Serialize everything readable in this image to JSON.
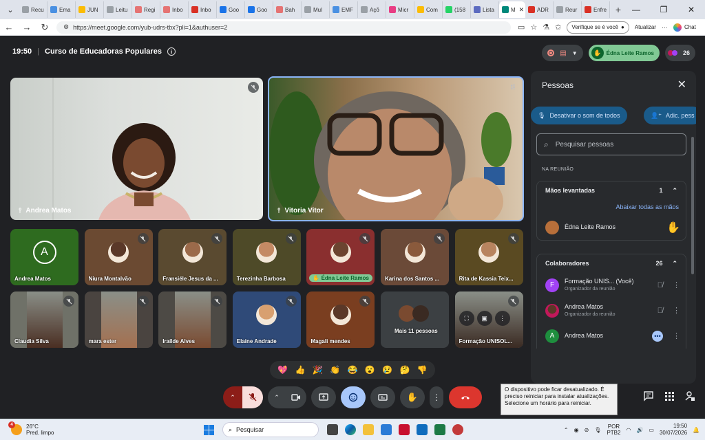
{
  "browser": {
    "tabs": [
      {
        "label": "Recu",
        "color": "#9aa0a6"
      },
      {
        "label": "Ema",
        "color": "#4a90e2"
      },
      {
        "label": "JUN",
        "color": "#fbbc04"
      },
      {
        "label": "Leitu",
        "color": "#9aa0a6"
      },
      {
        "label": "Regi",
        "color": "#e57373"
      },
      {
        "label": "Inbo",
        "color": "#e57373"
      },
      {
        "label": "Inbo",
        "color": "#d93025"
      },
      {
        "label": "Goo",
        "color": "#1a73e8"
      },
      {
        "label": "Goo",
        "color": "#1a73e8"
      },
      {
        "label": "Bah",
        "color": "#e57373"
      },
      {
        "label": "Mul",
        "color": "#9aa0a6"
      },
      {
        "label": "EMF",
        "color": "#4a90e2"
      },
      {
        "label": "Açõ",
        "color": "#9aa0a6"
      },
      {
        "label": "Micr",
        "color": "#e83d84"
      },
      {
        "label": "Com",
        "color": "#fbbc04"
      },
      {
        "label": "(158",
        "color": "#25d366"
      },
      {
        "label": "Lista",
        "color": "#5c6bc0"
      },
      {
        "label": "M",
        "color": "#00897b"
      },
      {
        "label": "ADR",
        "color": "#d93025"
      },
      {
        "label": "Reur",
        "color": "#9aa0a6"
      },
      {
        "label": "Enfre",
        "color": "#d93025"
      }
    ],
    "url": "https://meet.google.com/yub-udrs-tbx?pli=1&authuser=2",
    "verify_label": "Verifique se é você",
    "update_label": "Atualizar",
    "chat_label": "Chat"
  },
  "meet": {
    "time": "19:50",
    "title": "Curso de Educadoras Populares",
    "hand_chip_label": "Édna Leite Ramos",
    "people_count": "26",
    "big_tiles": [
      {
        "name": "Andrea Matos"
      },
      {
        "name": "Vitoria Vitor"
      }
    ],
    "grid_tiles": [
      {
        "name": "Andrea Matos",
        "bg": "#2e6b1f",
        "letter": "A"
      },
      {
        "name": "Niura Montalvão",
        "bg": "#6b4a32"
      },
      {
        "name": "Fransiéle Jesus da ...",
        "bg": "#5a4a30"
      },
      {
        "name": "Terezinha Barbosa",
        "bg": "#4e4a28"
      },
      {
        "name": "Édna Leite Ramos",
        "bg": "#8a2f2f"
      },
      {
        "name": "Karina dos Santos ...",
        "bg": "#6b4a38"
      },
      {
        "name": "Rita de Kassia Teix...",
        "bg": "#5a4a22"
      },
      {
        "name": "Claudia Silva",
        "bg": "#6f7168"
      },
      {
        "name": "mara ester",
        "bg": "#4a4440"
      },
      {
        "name": "Iraílde Alves",
        "bg": "#4d4a45"
      },
      {
        "name": "Elaine Andrade",
        "bg": "#2f4a78"
      },
      {
        "name": "Magali mendes",
        "bg": "#7a3e20"
      },
      {
        "name": "Mais 11 pessoas",
        "bg": "#3c4043"
      },
      {
        "name": "Formação UNISOL...",
        "bg": "#6b6a66"
      }
    ],
    "reactions": [
      "💖",
      "👍",
      "🎉",
      "👏",
      "😂",
      "😮",
      "😢",
      "🤔",
      "👎"
    ]
  },
  "panel": {
    "title": "Pessoas",
    "mute_all_label": "Desativar o som de todos",
    "add_people_label": "Adic. pess",
    "search_placeholder": "Pesquisar pessoas",
    "section_label": "NA REUNIÃO",
    "raised_hands": {
      "title": "Mãos levantadas",
      "count": "1",
      "lower_all": "Abaixar todas as mãos",
      "person": "Édna Leite Ramos"
    },
    "collaborators": {
      "title": "Colaboradores",
      "count": "26",
      "people": [
        {
          "name": "Formação UNIS...",
          "you": "(Você)",
          "sub": "Organizador da reunião",
          "letter": "F",
          "color": "#a142f4"
        },
        {
          "name": "Andrea Matos",
          "sub": "Organizador da reunião",
          "letter": "",
          "color": "#c2185b"
        },
        {
          "name": "Andrea Matos",
          "sub": "",
          "letter": "A",
          "color": "#1e8e3e"
        }
      ]
    }
  },
  "tooltip": "O dispositivo pode ficar desatualizado. É preciso reiniciar para instalar atualizações. Selecione um horário para reiniciar.",
  "taskbar": {
    "temp": "26°C",
    "weather": "Pred. limpo",
    "weather_badge": "4",
    "search_label": "Pesquisar",
    "lang1": "POR",
    "lang2": "PTB2",
    "time": "19:50",
    "date": "30/07/2026"
  }
}
